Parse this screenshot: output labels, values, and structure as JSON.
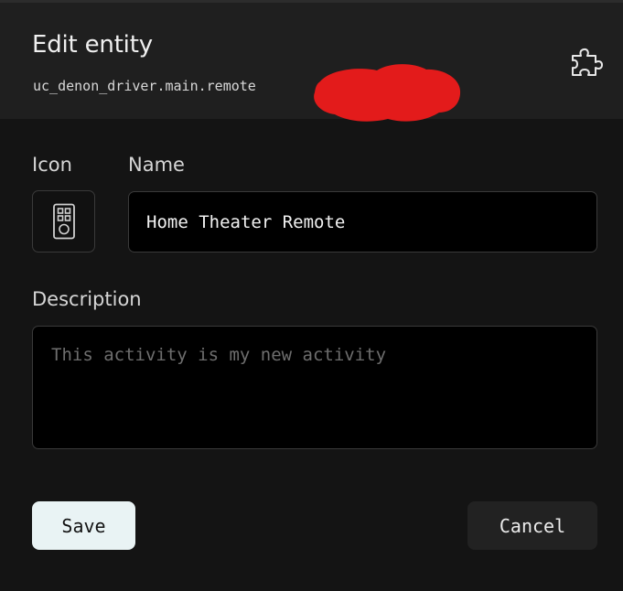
{
  "dialog": {
    "title": "Edit entity",
    "entity_id": "uc_denon_driver.main.remote",
    "header_icon": "puzzle-icon"
  },
  "form": {
    "icon_label": "Icon",
    "icon_value": "remote-control-icon",
    "name_label": "Name",
    "name_value": "Home Theater Remote",
    "description_label": "Description",
    "description_value": "",
    "description_placeholder": "This activity is my new activity"
  },
  "actions": {
    "save_label": "Save",
    "cancel_label": "Cancel"
  },
  "colors": {
    "background": "#141414",
    "header_background": "#1f1f1f",
    "input_background": "#000000",
    "save_button": "#e9f3f4",
    "cancel_button": "#222222",
    "redaction": "#e31b1b"
  }
}
